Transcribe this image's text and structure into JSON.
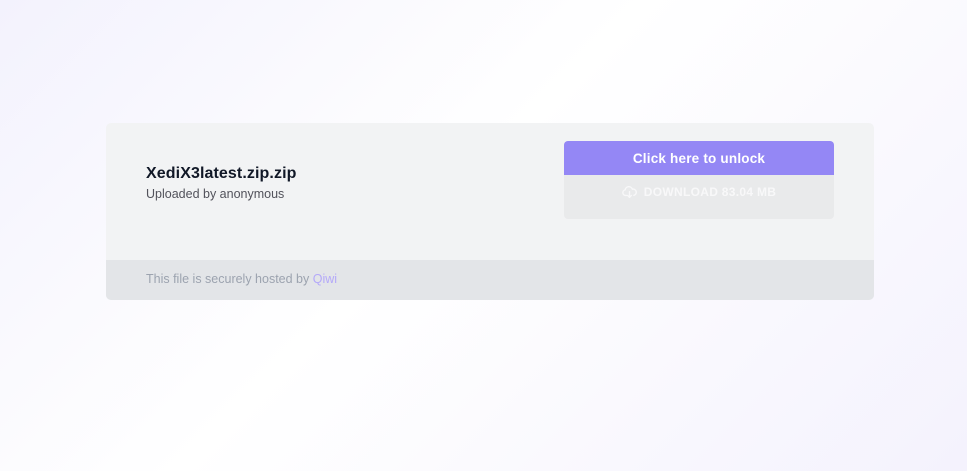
{
  "file": {
    "name": "XediX3latest.zip.zip",
    "uploader": "Uploaded by anonymous"
  },
  "actions": {
    "unlock_label": "Click here to unlock",
    "download_label": "DOWNLOAD 83.04 MB"
  },
  "footer": {
    "text": "This file is securely hosted by ",
    "link": "Qiwi"
  },
  "icons": {
    "download": "cloud-download-icon"
  },
  "colors": {
    "accent": "#9487f5",
    "link": "#b4a9f9",
    "card": "#f2f3f4",
    "footer": "#e3e5e8"
  }
}
